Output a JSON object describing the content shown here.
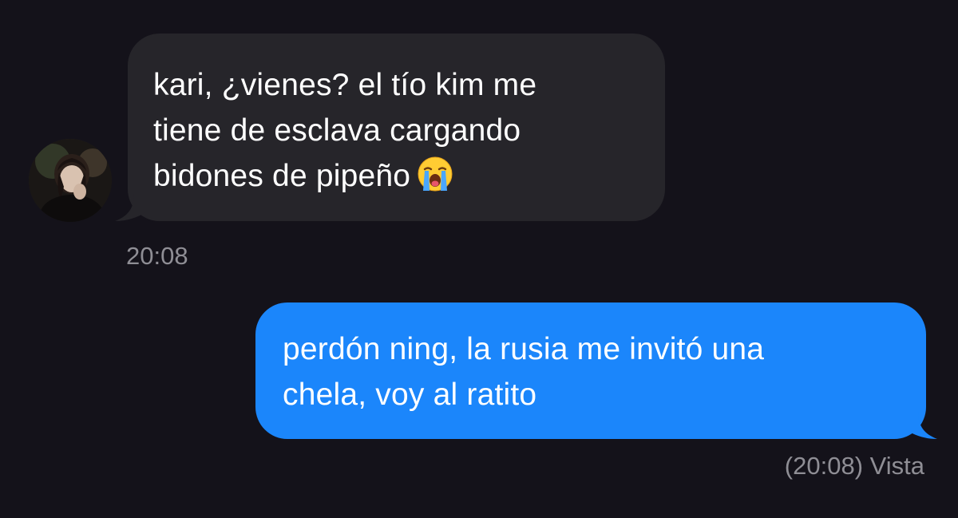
{
  "conversation": {
    "incoming": {
      "avatar_icon": "contact-avatar-photo",
      "lines": [
        "kari, ¿vienes? el tío kim me",
        "tiene de esclava cargando",
        "bidones de pipeño"
      ],
      "emoji": "loudly-crying-face",
      "timestamp": "20:08",
      "bubble_color": "#26252a"
    },
    "outgoing": {
      "lines": [
        "perdón ning, la rusia me invitó una",
        "chela, voy al ratito"
      ],
      "receipt": "(20:08) Vista",
      "bubble_color": "#1b86fb"
    },
    "background_color": "#14121a"
  }
}
